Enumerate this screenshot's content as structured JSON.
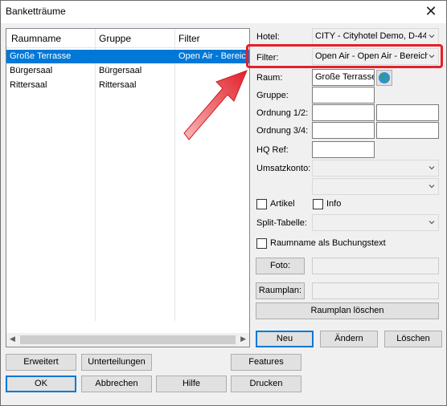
{
  "window": {
    "title": "Banketträume"
  },
  "list": {
    "columns": [
      "Raumname",
      "Gruppe",
      "Filter"
    ],
    "rows": [
      {
        "raumname": "Große Terrasse",
        "gruppe": "",
        "filter": "Open Air - Bereich",
        "selected": true
      },
      {
        "raumname": "Bürgersaal",
        "gruppe": "Bürgersaal",
        "filter": "",
        "selected": false
      },
      {
        "raumname": "Rittersaal",
        "gruppe": "Rittersaal",
        "filter": "",
        "selected": false
      }
    ]
  },
  "form": {
    "hotel_label": "Hotel:",
    "hotel_value": "CITY - Cityhotel Demo, D-44",
    "filter_label": "Filter:",
    "filter_value": "Open Air  - Open Air - Bereich",
    "raum_label": "Raum:",
    "raum_value": "Große Terrasse",
    "gruppe_label": "Gruppe:",
    "ordnung12_label": "Ordnung 1/2:",
    "ordnung34_label": "Ordnung 3/4:",
    "hqref_label": "HQ Ref:",
    "umsatzkonto_label": "Umsatzkonto:",
    "artikel_label": "Artikel",
    "info_label": "Info",
    "split_label": "Split-Tabelle:",
    "buchungstext_label": "Raumname als Buchungstext",
    "foto_button": "Foto:",
    "raumplan_button": "Raumplan:",
    "raumplan_loeschen": "Raumplan löschen",
    "neu": "Neu",
    "aendern": "Ändern",
    "loeschen": "Löschen"
  },
  "bottom": {
    "erweitert": "Erweitert",
    "unterteilungen": "Unterteilungen",
    "features": "Features",
    "ok": "OK",
    "abbrechen": "Abbrechen",
    "hilfe": "Hilfe",
    "drucken": "Drucken"
  },
  "colors": {
    "selection": "#0078d7",
    "highlight": "#e3202a"
  },
  "icons": {
    "globe": "globe-icon",
    "close": "close-icon"
  }
}
